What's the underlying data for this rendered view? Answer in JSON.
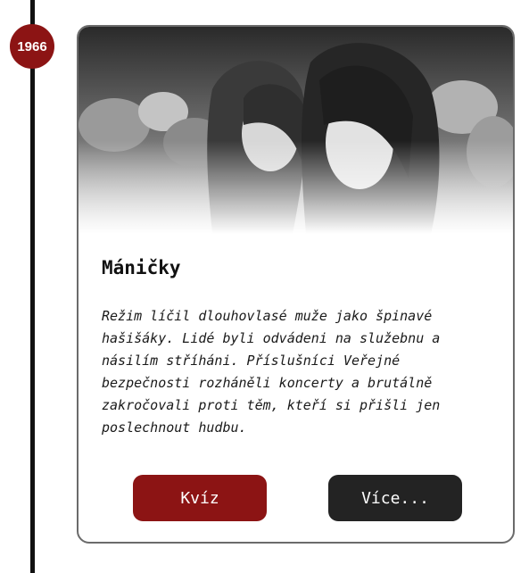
{
  "timeline": {
    "year": "1966"
  },
  "card": {
    "title": "Máničky",
    "text": "Režim líčil dlouhovlasé muže jako špinavé hašišáky. Lidé byli odvádeni na služebnu a násilím stříháni. Příslušníci Veřejné bezpečnosti rozháněli koncerty a brutálně zakročovali proti těm, kteří si přišli jen poslechnout hudbu.",
    "quiz_label": "Kvíz",
    "more_label": "Více..."
  },
  "colors": {
    "accent": "#8c1414",
    "dark_button": "#232323",
    "timeline": "#111111"
  }
}
